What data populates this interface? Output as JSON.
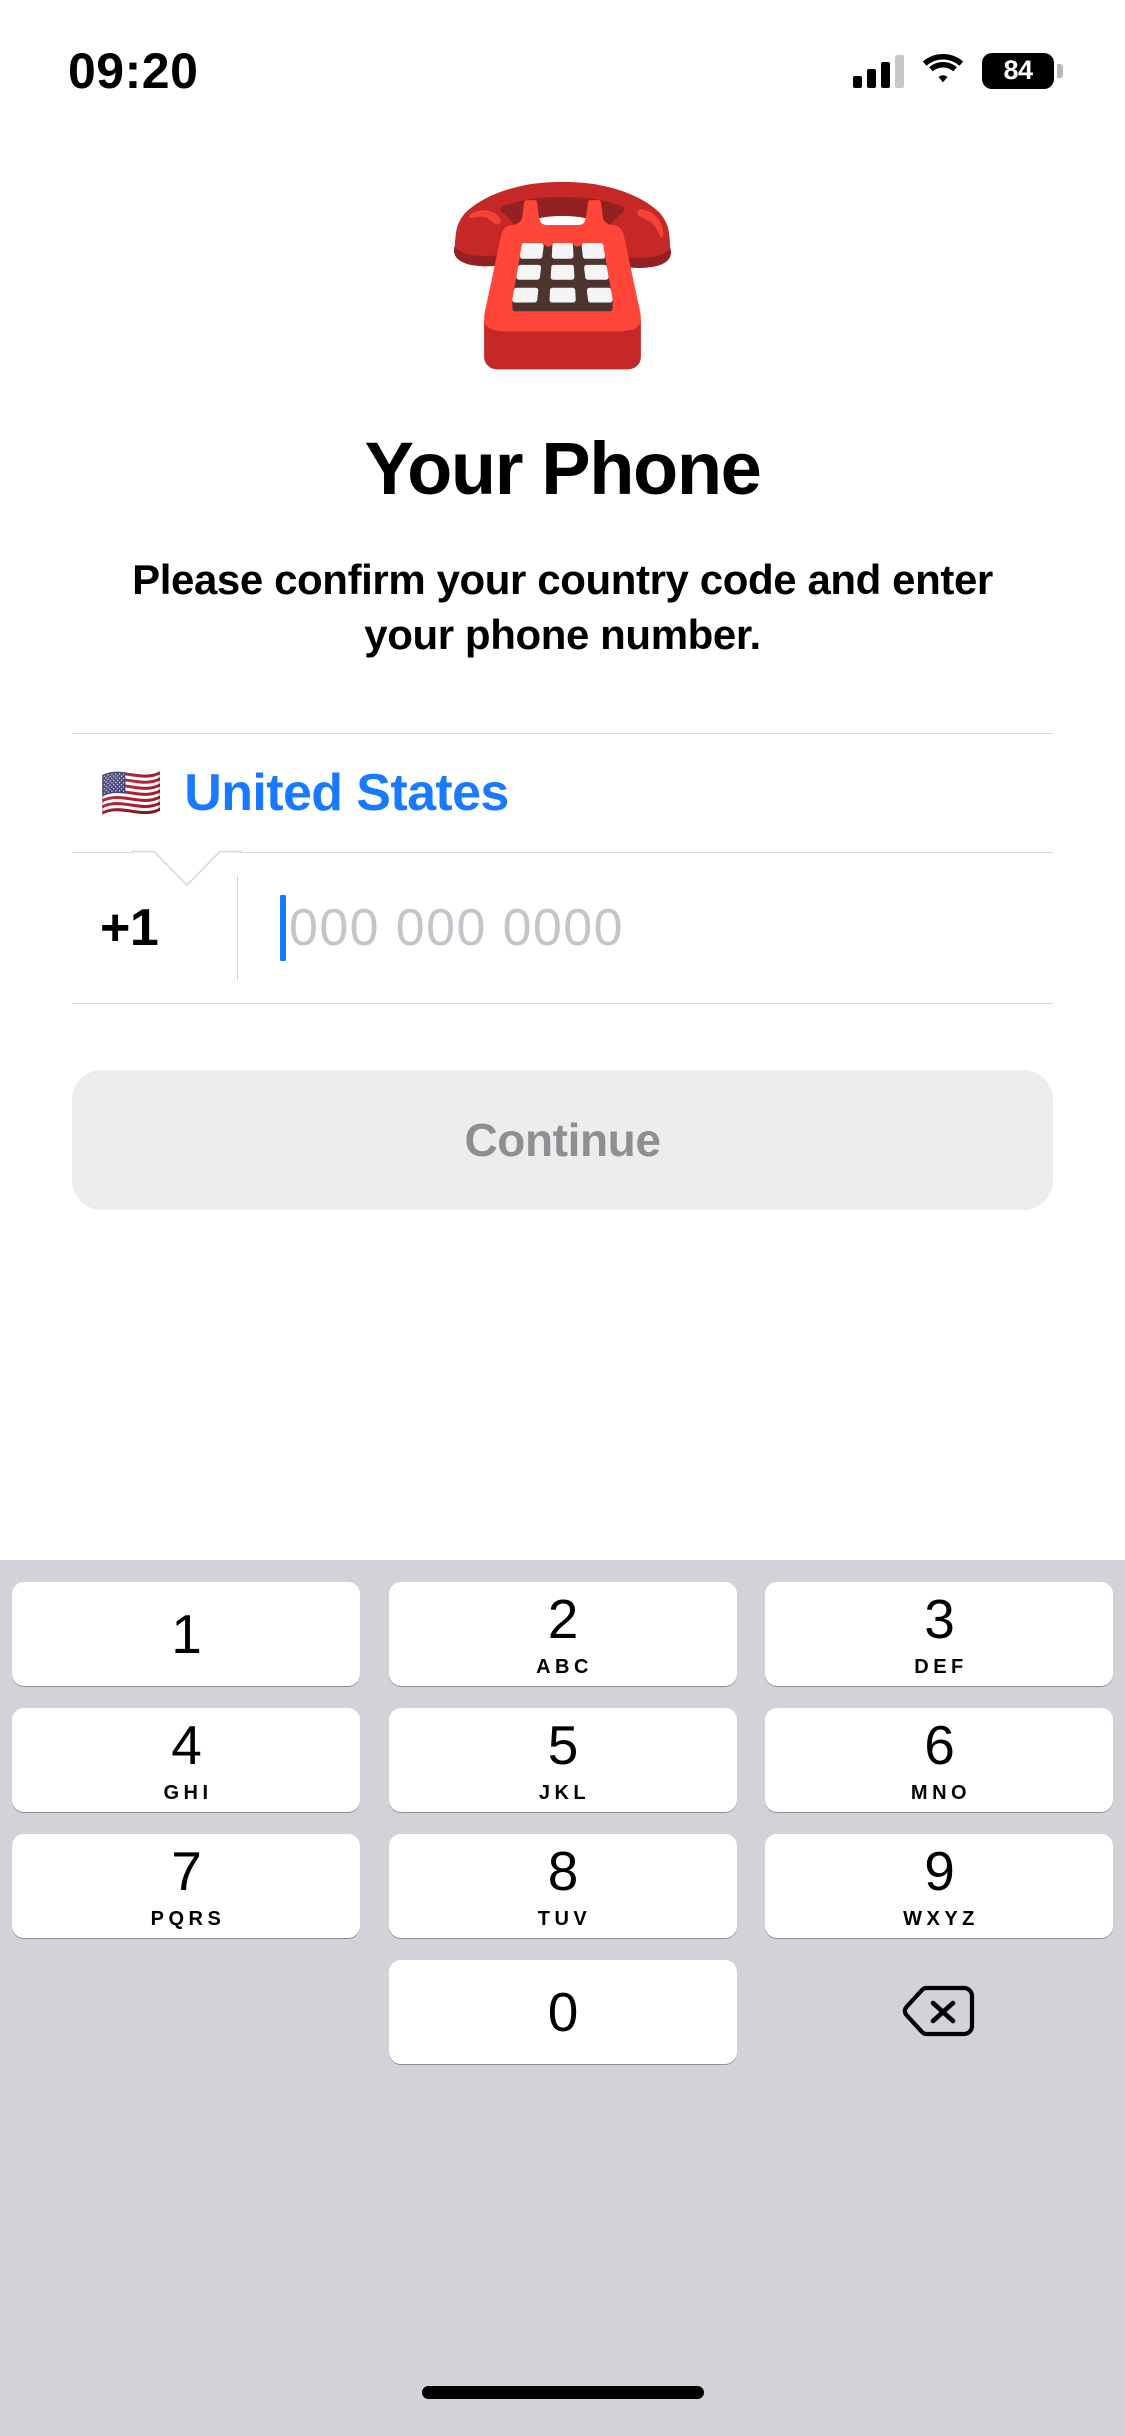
{
  "status_bar": {
    "time": "09:20",
    "signal_icon": "cellular-signal-icon",
    "wifi_icon": "wifi-icon",
    "battery_level": "84",
    "battery_icon": "battery-icon"
  },
  "hero": {
    "emoji": "☎️",
    "emoji_name": "telephone-emoji"
  },
  "header": {
    "title": "Your Phone",
    "subtitle": "Please confirm your country code and enter your phone number."
  },
  "country": {
    "flag": "🇺🇸",
    "name": "United States"
  },
  "phone": {
    "dial_code": "+1",
    "value": "",
    "placeholder": "000 000 0000"
  },
  "actions": {
    "continue_label": "Continue",
    "continue_enabled": false
  },
  "keypad": {
    "rows": [
      [
        {
          "digit": "1",
          "letters": ""
        },
        {
          "digit": "2",
          "letters": "ABC"
        },
        {
          "digit": "3",
          "letters": "DEF"
        }
      ],
      [
        {
          "digit": "4",
          "letters": "GHI"
        },
        {
          "digit": "5",
          "letters": "JKL"
        },
        {
          "digit": "6",
          "letters": "MNO"
        }
      ],
      [
        {
          "digit": "7",
          "letters": "PQRS"
        },
        {
          "digit": "8",
          "letters": "TUV"
        },
        {
          "digit": "9",
          "letters": "WXYZ"
        }
      ],
      [
        {
          "digit": "",
          "letters": "",
          "type": "spacer"
        },
        {
          "digit": "0",
          "letters": ""
        },
        {
          "digit": "",
          "letters": "",
          "type": "delete",
          "icon": "backspace-icon"
        }
      ]
    ]
  },
  "colors": {
    "accent_blue": "#1a7aff",
    "keypad_background": "#d1d3d9",
    "key_white": "#ffffff",
    "button_disabled_bg": "#ededed",
    "button_disabled_text": "#8e8e93",
    "placeholder_gray": "#c4c4ca",
    "divider_gray": "#d8d8dc"
  }
}
